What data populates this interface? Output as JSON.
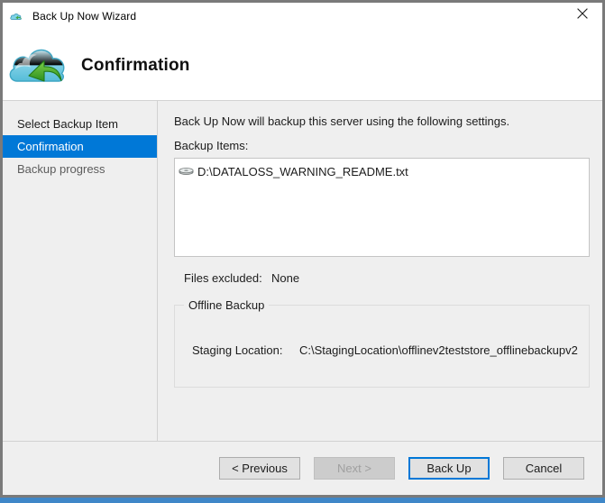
{
  "window": {
    "title": "Back Up Now Wizard",
    "title_icon": "cloud-backup-icon",
    "close_icon": "close-icon"
  },
  "header": {
    "icon": "cloud-restore-icon",
    "title": "Confirmation"
  },
  "sidebar": {
    "items": [
      {
        "label": "Select Backup Item",
        "state": "done"
      },
      {
        "label": "Confirmation",
        "state": "selected"
      },
      {
        "label": "Backup progress",
        "state": "upcoming"
      }
    ]
  },
  "main": {
    "intro_text": "Back Up Now will backup this server using the following settings.",
    "backup_items_label": "Backup Items:",
    "backup_items": [
      {
        "icon": "disk-drive-icon",
        "path": "D:\\DATALOSS_WARNING_README.txt"
      }
    ],
    "files_excluded_label": "Files excluded:",
    "files_excluded_value": "None",
    "offline_backup": {
      "legend": "Offline Backup",
      "staging_location_label": "Staging Location:",
      "staging_location_value": "C:\\StagingLocation\\offlinev2teststore_offlinebackupv2"
    }
  },
  "footer": {
    "buttons": [
      {
        "label": "< Previous",
        "state": "enabled"
      },
      {
        "label": "Next >",
        "state": "disabled"
      },
      {
        "label": "Back Up",
        "state": "focused"
      },
      {
        "label": "Cancel",
        "state": "enabled"
      }
    ]
  },
  "colors": {
    "accent": "#0078d7",
    "window_border": "#7a7a7a",
    "panel_bg": "#efefef",
    "desktop": "#3f87c8"
  }
}
